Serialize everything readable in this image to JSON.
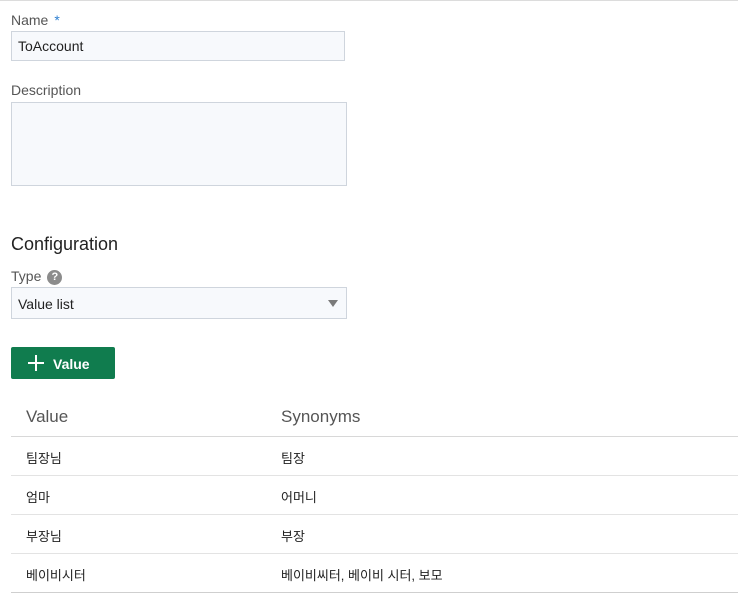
{
  "form": {
    "name_label": "Name",
    "required_mark": "*",
    "name_value": "ToAccount",
    "description_label": "Description",
    "description_value": ""
  },
  "configuration": {
    "title": "Configuration",
    "type_label": "Type",
    "help_glyph": "?",
    "type_value": "Value list",
    "add_button_label": "Value"
  },
  "table": {
    "headers": [
      "Value",
      "Synonyms"
    ],
    "rows": [
      {
        "value": "팀장님",
        "synonyms": "팀장"
      },
      {
        "value": "엄마",
        "synonyms": "어머니"
      },
      {
        "value": "부장님",
        "synonyms": "부장"
      },
      {
        "value": "베이비시터",
        "synonyms": "베이비씨터, 베이비 시터, 보모"
      }
    ]
  },
  "colors": {
    "accent": "#107c4e",
    "required": "#2d7fd1"
  },
  "icons": [
    "help-icon",
    "plus-icon",
    "chevron-down-icon"
  ]
}
